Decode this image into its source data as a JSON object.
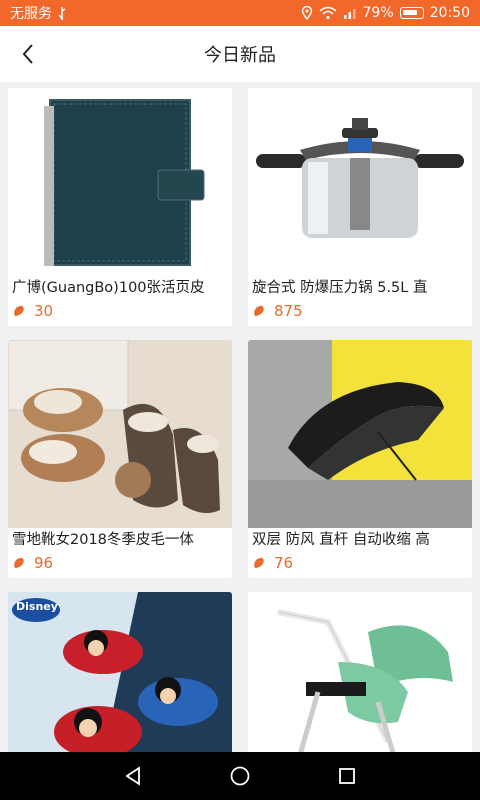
{
  "status_bar": {
    "carrier": "无服务",
    "battery": "79%",
    "time": "20:50"
  },
  "header": {
    "title": "今日新品"
  },
  "products": [
    {
      "name": "广博(GuangBo)100张活页皮",
      "price": "30",
      "image": "notebook"
    },
    {
      "name": "旋合式 防爆压力锅 5.5L 直",
      "price": "875",
      "image": "pressure-cooker"
    },
    {
      "name": "雪地靴女2018冬季皮毛一体",
      "price": "96",
      "image": "snow-boots"
    },
    {
      "name": "双层 防风 直杆 自动收缩 高",
      "price": "76",
      "image": "umbrella"
    },
    {
      "name": "",
      "price": "",
      "image": "kids-slippers",
      "brand_logo": "Disney"
    },
    {
      "name": "",
      "price": "",
      "image": "baby-stroller"
    }
  ],
  "colors": {
    "accent": "#f2672a",
    "price": "#e86a2c"
  },
  "icons": {
    "back": "chevron-left-icon",
    "coin": "price-coin-icon"
  }
}
